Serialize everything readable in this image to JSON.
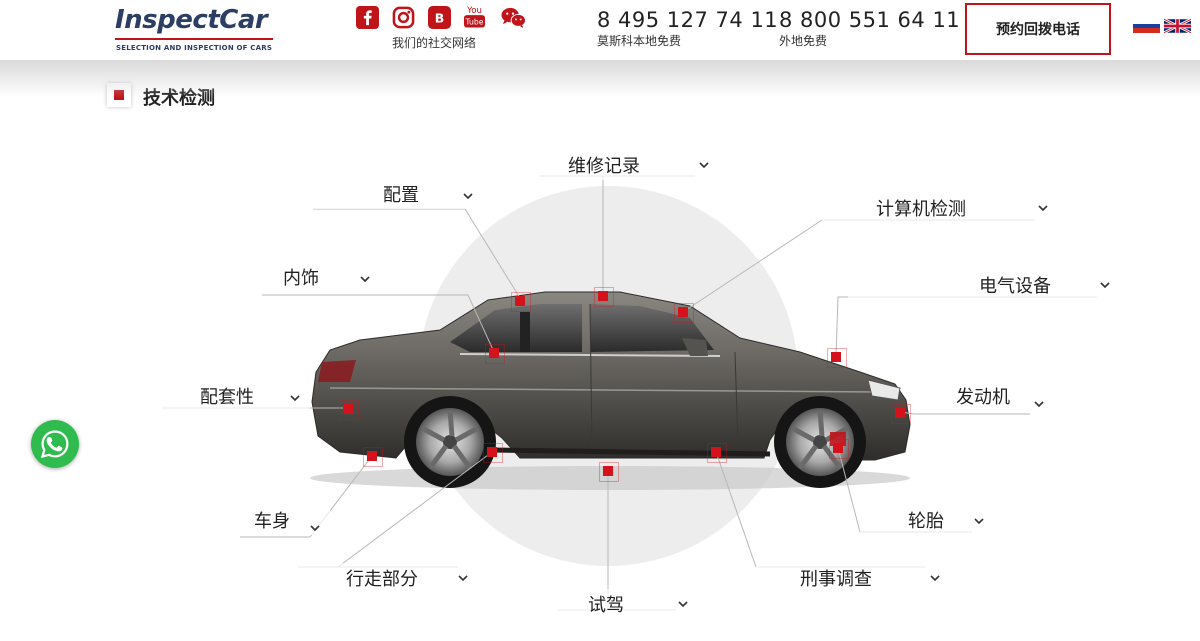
{
  "header": {
    "logo_text": "InspectCar",
    "logo_tagline": "SELECTION AND INSPECTION OF CARS",
    "social_icons": [
      "facebook-icon",
      "instagram-icon",
      "vk-icon",
      "youtube-icon",
      "wechat-icon"
    ],
    "social_label": "我们的社交网络",
    "phones": [
      {
        "number": "8 495 127 74 11",
        "note": "莫斯科本地免费"
      },
      {
        "number": "8 800 551 64 11",
        "note": "外地免费"
      }
    ],
    "callback_label": "预约回拨电话",
    "languages": [
      "ru-flag-icon",
      "uk-flag-icon"
    ]
  },
  "section": {
    "title": "技术检测"
  },
  "inspection_items": [
    {
      "id": "service-history",
      "label": "维修记录"
    },
    {
      "id": "configuration",
      "label": "配置"
    },
    {
      "id": "computer-diagnostics",
      "label": "计算机检测"
    },
    {
      "id": "interior",
      "label": "内饰"
    },
    {
      "id": "electrical",
      "label": "电气设备"
    },
    {
      "id": "completeness",
      "label": "配套性"
    },
    {
      "id": "engine",
      "label": "发动机"
    },
    {
      "id": "body",
      "label": "车身"
    },
    {
      "id": "tires",
      "label": "轮胎"
    },
    {
      "id": "chassis",
      "label": "行走部分"
    },
    {
      "id": "criminal-check",
      "label": "刑事调查"
    },
    {
      "id": "test-drive",
      "label": "试驾"
    }
  ],
  "colors": {
    "accent": "#c0141b",
    "logo_blue": "#2c3e63",
    "whatsapp_green": "#2fbb4d"
  },
  "floating": {
    "icon": "whatsapp-icon"
  }
}
